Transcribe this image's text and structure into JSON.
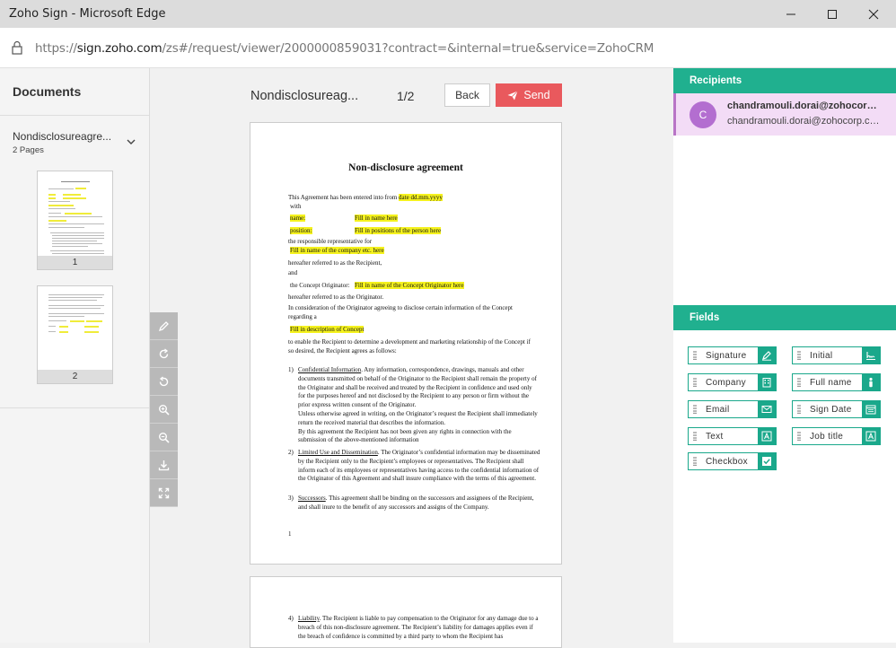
{
  "window": {
    "title": "Zoho Sign - Microsoft Edge"
  },
  "address": {
    "url_prefix": "https://",
    "url_host": "sign.zoho.com",
    "url_rest": "/zs#/request/viewer/2000000859031?contract=&internal=true&service=ZohoCRM"
  },
  "documents": {
    "title": "Documents",
    "name": "Nondisclosureagre...",
    "pages": "2 Pages",
    "thumbs": [
      "1",
      "2"
    ]
  },
  "viewer": {
    "doc_name": "Nondisclosureag...",
    "page_indicator": "1/2",
    "back_label": "Back",
    "send_label": "Send"
  },
  "page1": {
    "title": "Non-disclosure agreement",
    "l1": "This Agreement has been entered into from",
    "l1_hl": "date dd.mm.yyyy",
    "l2": "with",
    "name_label": "name:",
    "name_value": "Fill in name here",
    "position_label": "position:",
    "position_value": "Fill in positions of the person here",
    "l3": "the responsible representative for",
    "company_value": "Fill in name of the company etc. here",
    "l4": "hereafter referred to as the Recipient,",
    "l5": "and",
    "originator_label": "the Concept Originator:",
    "originator_value": "Fill in name of the Concept Originator here",
    "l6": "hereafter referred to as the Originator.",
    "l7": "In consideration of the Originator agreeing to disclose certain information of the Concept",
    "l8": "regarding a",
    "concept_value": "Fill in description of Concept",
    "l9": "to enable the Recipient to determine a development and marketing relationship of the Concept if",
    "l10": "so desired, the Recipient agrees as follows:",
    "s1_num": "1)",
    "s1_head": "Confidential Information",
    "s1_text": ". Any information, correspondence, drawings, manuals and other documents transmitted on behalf of the Originator to the Recipient shall remain the property of the Originator and shall be received and treated by the Recipient in confidence and used only for the purposes hereof and not disclosed by the Recipient to any person or firm without the prior express written consent of the Originator.",
    "s1_text2": "Unless otherwise agreed in writing, on the Originator’s request the Recipient shall immediately return the received material that describes the information.",
    "s1_text3": "By this agreement the Recipient has not been given any rights in connection with the submission of the above-mentioned information",
    "s2_num": "2)",
    "s2_head": "Limited Use and Dissemination",
    "s2_text": ". The Originator’s confidential information may be disseminated by the Recipient only to the Recipient’s employees or representatives. The Recipient shall inform each of its employees or representatives having access to the confidential information of the Originator of this Agreement and shall insure compliance with the terms of this agreement.",
    "s3_num": "3)",
    "s3_head": "Successors",
    "s3_text": ". This agreement shall be binding on the successors and assignees of the Recipient, and shall inure to the benefit of any successors and assigns of the Company.",
    "footer": "1"
  },
  "page2": {
    "s4_num": "4)",
    "s4_head": "Liability",
    "s4_text": ". The Recipient is liable to pay compensation to the Originator for any damage due to a breach of this non-disclosure agreement. The Recipient’s liability for damages applies even if the breach of confidence is committed by a third party to whom the Recipient has"
  },
  "recipients": {
    "header": "Recipients",
    "avatar_letter": "C",
    "name": "chandramouli.dorai@zohocorp.com",
    "email": "chandramouli.dorai@zohocorp.com"
  },
  "fields": {
    "header": "Fields",
    "items": {
      "signature": "Signature",
      "initial": "Initial",
      "company": "Company",
      "full_name": "Full name",
      "email": "Email",
      "sign_date": "Sign Date",
      "text": "Text",
      "job_title": "Job title",
      "checkbox": "Checkbox"
    }
  },
  "colors": {
    "accent": "#20b08f",
    "send": "#e9595d",
    "recipient_bg": "#f3dcf6",
    "avatar": "#b36ed0",
    "highlight": "#f5f21e"
  }
}
